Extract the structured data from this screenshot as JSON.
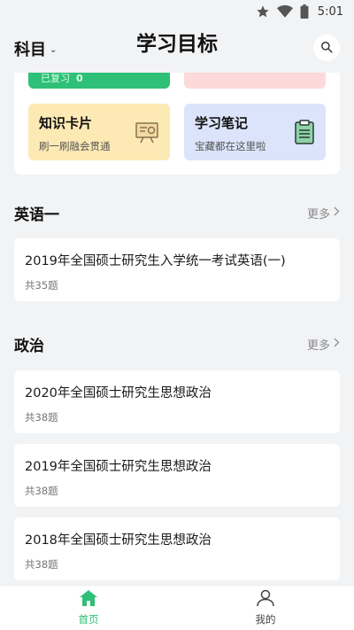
{
  "status_bar": {
    "time": "5:01"
  },
  "header": {
    "subject_label": "科目",
    "title": "学习目标"
  },
  "top_tiles": {
    "green_partial_text": "已复习",
    "green_partial_value": "0"
  },
  "feature_tiles": [
    {
      "title": "知识卡片",
      "subtitle": "刷一刷融会贯通",
      "icon": "presentation-board-icon"
    },
    {
      "title": "学习笔记",
      "subtitle": "宝藏都在这里啦",
      "icon": "clipboard-icon"
    }
  ],
  "sections": [
    {
      "title": "英语一",
      "more_label": "更多",
      "papers": [
        {
          "title": "2019年全国硕士研究生入学统一考试英语(一)",
          "count": "共35题"
        }
      ]
    },
    {
      "title": "政治",
      "more_label": "更多",
      "papers": [
        {
          "title": "2020年全国硕士研究生思想政治",
          "count": "共38题"
        },
        {
          "title": "2019年全国硕士研究生思想政治",
          "count": "共38题"
        },
        {
          "title": "2018年全国硕士研究生思想政治",
          "count": "共38题"
        }
      ]
    }
  ],
  "tabbar": {
    "home_label": "首页",
    "mine_label": "我的"
  },
  "colors": {
    "accent": "#2ec076",
    "background": "#f2f3f5",
    "yellow_tile": "#fde9b4",
    "blue_tile": "#dbe4fb",
    "pink_tile": "#fdd9d9"
  }
}
